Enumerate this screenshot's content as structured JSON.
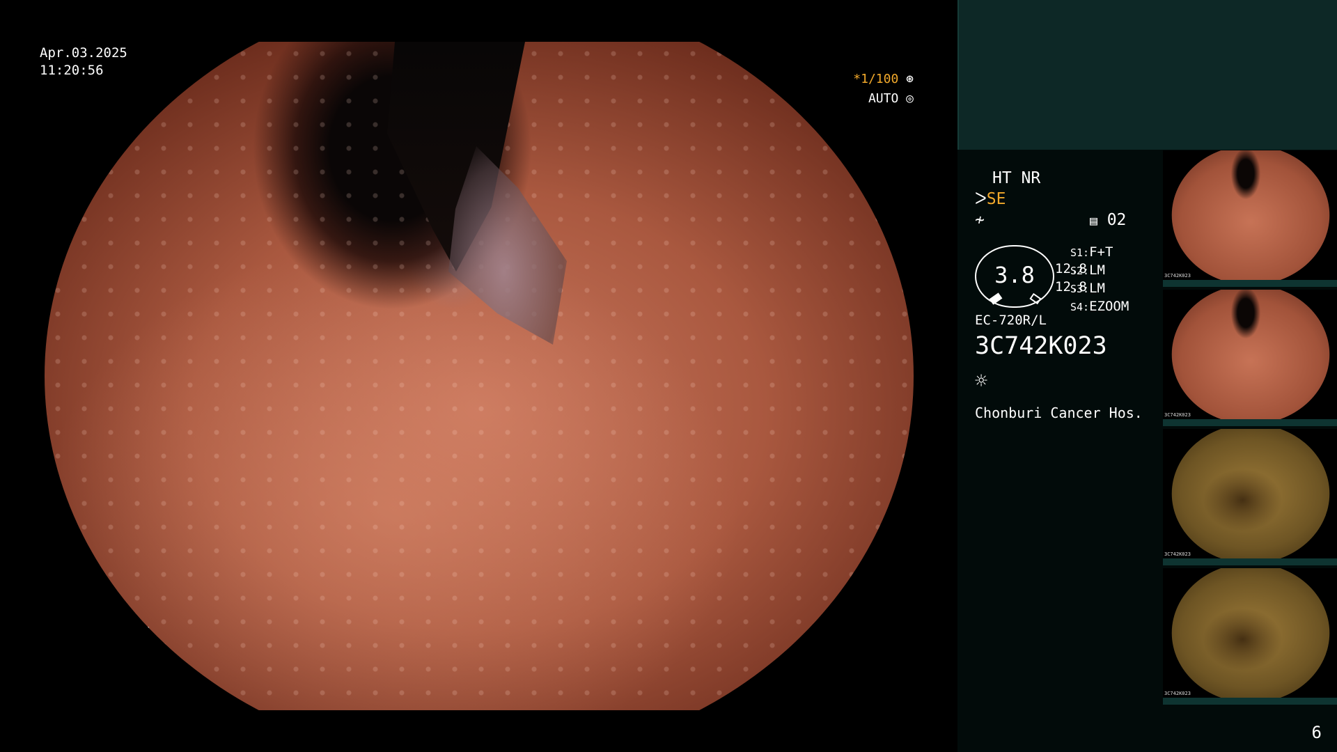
{
  "overlay": {
    "date": "Apr.03.2025",
    "time": "11:20:56",
    "shutter": "*1/100",
    "iris": "AUTO"
  },
  "panel": {
    "mode": "HT NR",
    "enhance": "SE",
    "channel": "02",
    "gauge_value": "3.8",
    "flow_values": [
      "12.8",
      "12.8"
    ],
    "settings": [
      {
        "key": "S1:",
        "value": "F+T"
      },
      {
        "key": "S2:",
        "value": "LM"
      },
      {
        "key": "S3:",
        "value": "LM"
      },
      {
        "key": "S4:",
        "value": "EZOOM"
      }
    ],
    "model": "EC-720R/L",
    "serial": "3C742K023",
    "hospital": "Chonburi Cancer Hos."
  },
  "thumbnails": [
    {
      "tone": "red",
      "serial": "3C742K023"
    },
    {
      "tone": "red",
      "serial": "3C742K023"
    },
    {
      "tone": "yellow",
      "serial": "3C742K023"
    },
    {
      "tone": "yellow",
      "serial": "3C742K023"
    }
  ],
  "page_number": "6",
  "colors": {
    "accent": "#f2a92b",
    "panel_header": "#0d2826",
    "panel_bg": "#020b0a"
  },
  "icons": {
    "shutter": "aperture-icon",
    "iris": "iris-icon",
    "structure": "structure-enhance-icon",
    "color": "color-enhance-icon",
    "channel": "channel-icon",
    "light": "light-source-icon"
  }
}
